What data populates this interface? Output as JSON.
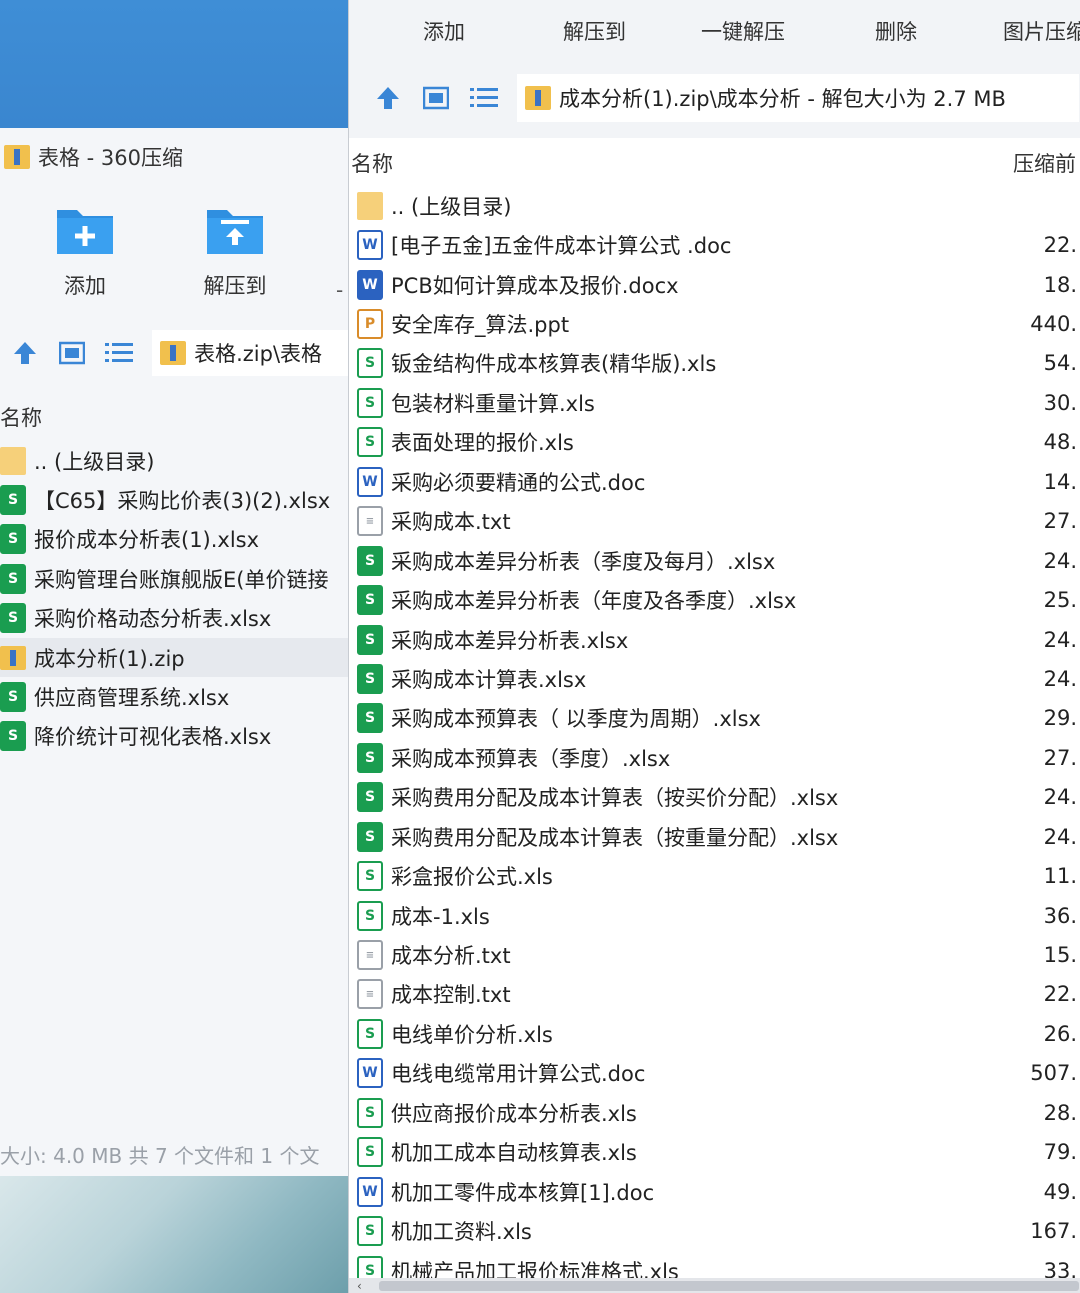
{
  "left_window": {
    "title": "表格 - 360压缩",
    "tools": [
      {
        "label": "添加",
        "icon": "add-folder-icon"
      },
      {
        "label": "解压到",
        "icon": "extract-folder-icon"
      }
    ],
    "more_dash": "-",
    "path": "表格.zip\\表格",
    "column_name": "名称",
    "files": [
      {
        "name": ".. (上级目录)",
        "icon": "folder"
      },
      {
        "name": "【C65】采购比价表(3)(2).xlsx",
        "icon": "xlsx"
      },
      {
        "name": "报价成本分析表(1).xlsx",
        "icon": "xlsx"
      },
      {
        "name": "采购管理台账旗舰版E(单价链接",
        "icon": "xlsx"
      },
      {
        "name": "采购价格动态分析表.xlsx",
        "icon": "xlsx"
      },
      {
        "name": "成本分析(1).zip",
        "icon": "zip",
        "selected": true
      },
      {
        "name": "供应商管理系统.xlsx",
        "icon": "xlsx"
      },
      {
        "name": "降价统计可视化表格.xlsx",
        "icon": "xlsx"
      }
    ],
    "status": "大小: 4.0 MB 共 7 个文件和 1 个文"
  },
  "right_window": {
    "toolbar": [
      "添加",
      "解压到",
      "一键解压",
      "删除",
      "图片压缩"
    ],
    "path": "成本分析(1).zip\\成本分析 - 解包大小为 2.7 MB",
    "column_name": "名称",
    "column_size": "压缩前",
    "files": [
      {
        "name": ".. (上级目录)",
        "icon": "folder",
        "size": ""
      },
      {
        "name": "[电子五金]五金件成本计算公式 .doc",
        "icon": "doc",
        "size": "22."
      },
      {
        "name": "PCB如何计算成本及报价.docx",
        "icon": "docx",
        "size": "18."
      },
      {
        "name": "安全库存_算法.ppt",
        "icon": "ppt",
        "size": "440."
      },
      {
        "name": "钣金结构件成本核算表(精华版).xls",
        "icon": "xls",
        "size": "54."
      },
      {
        "name": "包装材料重量计算.xls",
        "icon": "xls",
        "size": "30."
      },
      {
        "name": "表面处理的报价.xls",
        "icon": "xls",
        "size": "48."
      },
      {
        "name": "采购必须要精通的公式.doc",
        "icon": "doc",
        "size": "14."
      },
      {
        "name": "采购成本.txt",
        "icon": "txt",
        "size": "27."
      },
      {
        "name": "采购成本差异分析表（季度及每月）.xlsx",
        "icon": "xlsx",
        "size": "24."
      },
      {
        "name": "采购成本差异分析表（年度及各季度）.xlsx",
        "icon": "xlsx",
        "size": "25."
      },
      {
        "name": "采购成本差异分析表.xlsx",
        "icon": "xlsx",
        "size": "24."
      },
      {
        "name": "采购成本计算表.xlsx",
        "icon": "xlsx",
        "size": "24."
      },
      {
        "name": "采购成本预算表（ 以季度为周期）.xlsx",
        "icon": "xlsx",
        "size": "29."
      },
      {
        "name": "采购成本预算表（季度）.xlsx",
        "icon": "xlsx",
        "size": "27."
      },
      {
        "name": "采购费用分配及成本计算表（按买价分配）.xlsx",
        "icon": "xlsx",
        "size": "24."
      },
      {
        "name": "采购费用分配及成本计算表（按重量分配）.xlsx",
        "icon": "xlsx",
        "size": "24."
      },
      {
        "name": "彩盒报价公式.xls",
        "icon": "xls",
        "size": "11."
      },
      {
        "name": "成本-1.xls",
        "icon": "xls",
        "size": "36."
      },
      {
        "name": "成本分析.txt",
        "icon": "txt",
        "size": "15."
      },
      {
        "name": "成本控制.txt",
        "icon": "txt",
        "size": "22."
      },
      {
        "name": "电线单价分析.xls",
        "icon": "xls",
        "size": "26."
      },
      {
        "name": "电线电缆常用计算公式.doc",
        "icon": "doc",
        "size": "507."
      },
      {
        "name": "供应商报价成本分析表.xls",
        "icon": "xls",
        "size": "28."
      },
      {
        "name": "机加工成本自动核算表.xls",
        "icon": "xls",
        "size": "79."
      },
      {
        "name": "机加工零件成本核算[1].doc",
        "icon": "doc",
        "size": "49."
      },
      {
        "name": "机加工资料.xls",
        "icon": "xls",
        "size": "167."
      },
      {
        "name": "机械产品加工报价标准格式.xls",
        "icon": "xls",
        "size": "33."
      }
    ]
  }
}
